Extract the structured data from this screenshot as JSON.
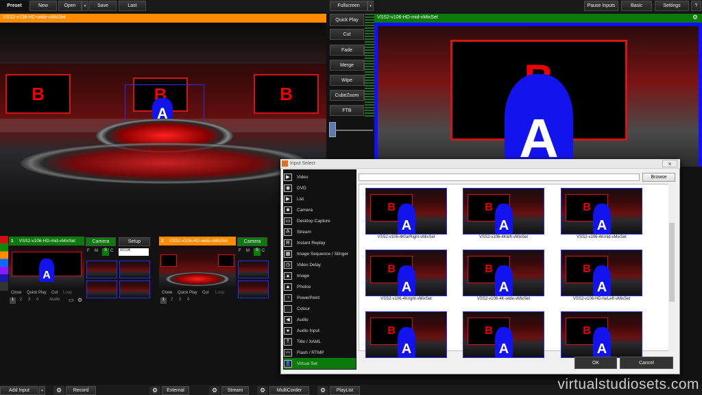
{
  "toolbar": {
    "preset_label": "Preset",
    "new_label": "New",
    "open_label": "Open",
    "save_label": "Save",
    "last_label": "Last",
    "fullscreen_label": "Fullscreen",
    "pause_inputs_label": "Pause Inputs",
    "basic_label": "Basic",
    "settings_label": "Settings",
    "help_label": "?"
  },
  "preview": {
    "title": "VSS2-v106-HD-wide-vMixSet",
    "screen_letter": "B",
    "talent_letter": "A"
  },
  "output": {
    "title": "VSS2-v106-HD-mid-vMixSet",
    "screen_letter": "B",
    "talent_letter": "A",
    "gear": "⚙"
  },
  "transitions": {
    "quick_play": "Quick Play",
    "cut": "Cut",
    "fade": "Fade",
    "merge": "Merge",
    "wipe": "Wipe",
    "cubezoom": "CubeZoom",
    "ftb": "FTB"
  },
  "inputs": [
    {
      "number": "1",
      "title": "VSS2-v106-HD-mid-vMixSet",
      "camera_label": "Camera",
      "setup_label": "Setup",
      "f": "F",
      "m": "M",
      "s": "S",
      "c": "C",
      "timecode": "00:04",
      "close": "Close",
      "quick_play": "Quick Play",
      "cut": "Cut",
      "loop": "Loop",
      "audio": "Audio",
      "num1": "1",
      "num2": "2",
      "num3": "3",
      "num4": "4"
    },
    {
      "number": "2",
      "title": "VSS2-v106-HD-wide-vMixSet",
      "camera_label": "Camera",
      "f": "F",
      "m": "M",
      "s": "S",
      "c": "C",
      "close": "Close",
      "quick_play": "Quick Play",
      "cut": "Cut",
      "loop": "Loop",
      "num1": "1",
      "num2": "2",
      "num3": "3",
      "num4": "4"
    }
  ],
  "dialog": {
    "title": "Input Select",
    "close": "×",
    "browse_label": "Browse",
    "ok_label": "OK",
    "cancel_label": "Cancel",
    "types": [
      {
        "label": "Video",
        "icon": "video-icon",
        "glyph": "▶"
      },
      {
        "label": "DVD",
        "icon": "dvd-icon",
        "glyph": "◉"
      },
      {
        "label": "List",
        "icon": "list-icon",
        "glyph": "▶"
      },
      {
        "label": "Camera",
        "icon": "camera-icon",
        "glyph": "■"
      },
      {
        "label": "Desktop Capture",
        "icon": "monitor-icon",
        "glyph": "▭"
      },
      {
        "label": "Stream",
        "icon": "antenna-icon",
        "glyph": "Ⲁ"
      },
      {
        "label": "Instant Replay",
        "icon": "replay-icon",
        "glyph": "R"
      },
      {
        "label": "Image Sequence / Stinger",
        "icon": "image-sequence-icon",
        "glyph": "▦"
      },
      {
        "label": "Video Delay",
        "icon": "clock-icon",
        "glyph": "◷"
      },
      {
        "label": "Image",
        "icon": "image-icon",
        "glyph": "▲"
      },
      {
        "label": "Photos",
        "icon": "photos-icon",
        "glyph": "▲"
      },
      {
        "label": "PowerPoint",
        "icon": "powerpoint-icon",
        "glyph": "◔"
      },
      {
        "label": "Colour",
        "icon": "colour-icon",
        "glyph": ""
      },
      {
        "label": "Audio",
        "icon": "speaker-icon",
        "glyph": "◀"
      },
      {
        "label": "Audio Input",
        "icon": "microphone-icon",
        "glyph": "●"
      },
      {
        "label": "Title / XAML",
        "icon": "title-icon",
        "glyph": "T"
      },
      {
        "label": "Flash / RTMP",
        "icon": "flash-icon",
        "glyph": "〰"
      },
      {
        "label": "Virtual Set",
        "icon": "virtual-set-icon",
        "glyph": "👤"
      }
    ],
    "selected_type": "Virtual Set",
    "path_value": "",
    "thumbs": [
      {
        "label": "VSS2-v106-4KfarRight-vMixSet"
      },
      {
        "label": "VSS2-v106-4Kleft-vMixSet"
      },
      {
        "label": "VSS2-v106-4Kmid-vMixSet"
      },
      {
        "label": "VSS2-v106-4Kright-vMixSet"
      },
      {
        "label": "VSS2-v106-4K-wide-vMixSet"
      },
      {
        "label": "VSS2-v106-HD-farLeft-vMixSet"
      },
      {
        "label": ""
      },
      {
        "label": ""
      },
      {
        "label": ""
      }
    ],
    "thumb_screen_letter": "B",
    "thumb_talent_letter": "A"
  },
  "bottom": {
    "add_input": "Add Input",
    "record": "Record",
    "external": "External",
    "stream": "Stream",
    "multicorder": "MultiCorder",
    "playlist": "PlayList",
    "gear": "⚙",
    "watermark": "virtualstudiosets.com"
  },
  "colors": {
    "preview_bar": "#ff8c00",
    "output_bar": "#0a7a0a",
    "live_border": "#1010ff",
    "selected": "#0a7a0a"
  }
}
